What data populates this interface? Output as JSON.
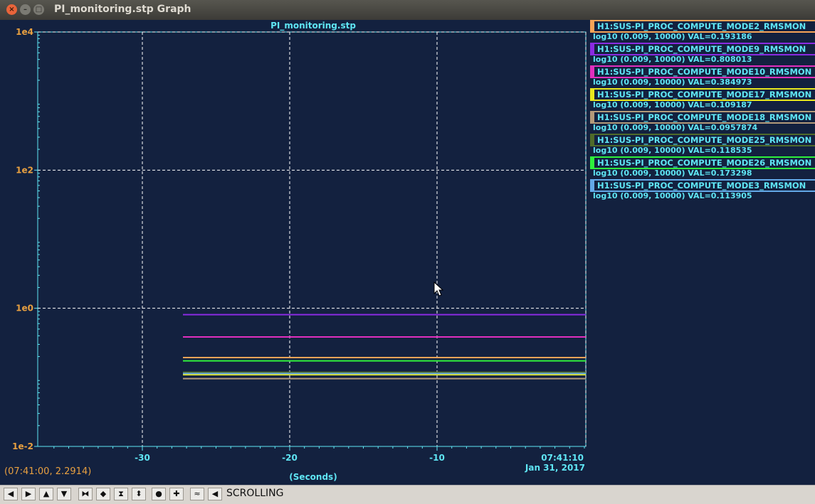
{
  "window": {
    "title": "PI_monitoring.stp Graph"
  },
  "plot": {
    "title": "PI_monitoring.stp",
    "xlabel": "(Seconds)",
    "cursor_readout": "(07:41:00, 2.2914)",
    "time_label": "07:41:10",
    "date_label": "Jan 31, 2017"
  },
  "chart_data": {
    "type": "line",
    "title": "PI_monitoring.stp",
    "xlabel": "(Seconds)",
    "ylabel": "",
    "yscale": "log",
    "xlim": [
      -37,
      1
    ],
    "ylim": [
      0.009,
      10000
    ],
    "x_ticks": [
      -30,
      -20,
      -10
    ],
    "y_ticks": [
      {
        "value": 10000,
        "label": "1e4"
      },
      {
        "value": 100,
        "label": "1e2"
      },
      {
        "value": 1,
        "label": "1e0"
      },
      {
        "value": 0.01,
        "label": "1e-2"
      }
    ],
    "grid": true,
    "legend_placement": "right",
    "series": [
      {
        "name": "H1:SUS-PI_PROC_COMPUTE_MODE2_RMSMON",
        "sub": "log10 (0.009, 10000) VAL=0.193186",
        "color": "#f7a457",
        "x": [
          -27.2,
          0.5
        ],
        "y": [
          0.193186,
          0.193186
        ]
      },
      {
        "name": "H1:SUS-PI_PROC_COMPUTE_MODE9_RMSMON",
        "sub": "log10 (0.009, 10000) VAL=0.808013",
        "color": "#8a2be2",
        "x": [
          -27.2,
          0.5
        ],
        "y": [
          0.808013,
          0.808013
        ]
      },
      {
        "name": "H1:SUS-PI_PROC_COMPUTE_MODE10_RMSMON",
        "sub": "log10 (0.009, 10000) VAL=0.384973",
        "color": "#e12fbe",
        "x": [
          -27.2,
          0.5
        ],
        "y": [
          0.384973,
          0.384973
        ]
      },
      {
        "name": "H1:SUS-PI_PROC_COMPUTE_MODE17_RMSMON",
        "sub": "log10 (0.009, 10000) VAL=0.109187",
        "color": "#e8e81e",
        "x": [
          -27.2,
          0.5
        ],
        "y": [
          0.109187,
          0.109187
        ]
      },
      {
        "name": "H1:SUS-PI_PROC_COMPUTE_MODE18_RMSMON",
        "sub": "log10 (0.009, 10000) VAL=0.0957874",
        "color": "#b39a7a",
        "x": [
          -27.2,
          0.5
        ],
        "y": [
          0.0957874,
          0.0957874
        ]
      },
      {
        "name": "H1:SUS-PI_PROC_COMPUTE_MODE25_RMSMON",
        "sub": "log10 (0.009, 10000) VAL=0.118535",
        "color": "#4f6b2a",
        "x": [
          -27.2,
          0.5
        ],
        "y": [
          0.118535,
          0.118535
        ]
      },
      {
        "name": "H1:SUS-PI_PROC_COMPUTE_MODE26_RMSMON",
        "sub": "log10 (0.009, 10000) VAL=0.173298",
        "color": "#2ef03c",
        "x": [
          -27.2,
          0.5
        ],
        "y": [
          0.173298,
          0.173298
        ]
      },
      {
        "name": "H1:SUS-PI_PROC_COMPUTE_MODE3_RMSMON",
        "sub": "log10 (0.009, 10000) VAL=0.113905",
        "color": "#63a9e8",
        "x": [
          -27.2,
          0.5
        ],
        "y": [
          0.113905,
          0.113905
        ]
      }
    ]
  },
  "toolbar": {
    "status": "SCROLLING",
    "buttons": [
      {
        "name": "scroll-left-button",
        "glyph": "◀"
      },
      {
        "name": "scroll-right-button",
        "glyph": "▶"
      },
      {
        "name": "scroll-up-button",
        "glyph": "▲"
      },
      {
        "name": "scroll-down-button",
        "glyph": "▼"
      },
      {
        "name": "compress-x-button",
        "glyph": "⧓"
      },
      {
        "name": "expand-x-button",
        "glyph": "◆"
      },
      {
        "name": "compress-y-button",
        "glyph": "⧗"
      },
      {
        "name": "expand-y-button",
        "glyph": "⬍"
      },
      {
        "name": "reset-button",
        "glyph": "●"
      },
      {
        "name": "add-button",
        "glyph": "✚"
      },
      {
        "name": "autoscale-button",
        "glyph": "≈"
      },
      {
        "name": "pan-left-button",
        "glyph": "◀"
      }
    ]
  }
}
